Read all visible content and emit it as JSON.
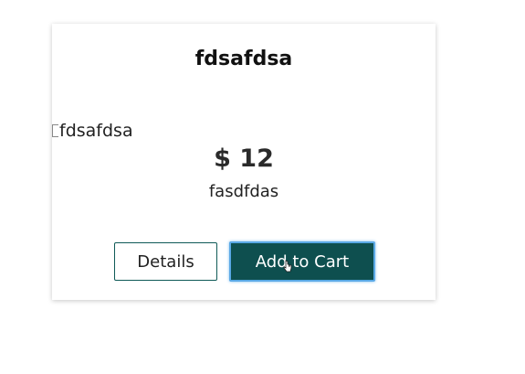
{
  "card": {
    "title": "fdsafdsa",
    "image_alt": "fdsafdsa",
    "price": "$ 12",
    "description": "fasdfdas"
  },
  "buttons": {
    "details_label": "Details",
    "add_to_cart_label": "Add to Cart"
  },
  "colors": {
    "accent": "#0e4f4f",
    "focus_ring": "#5aa9e6"
  },
  "icons": {
    "broken_image": "broken-image-icon",
    "cursor": "pointer-cursor-icon"
  }
}
